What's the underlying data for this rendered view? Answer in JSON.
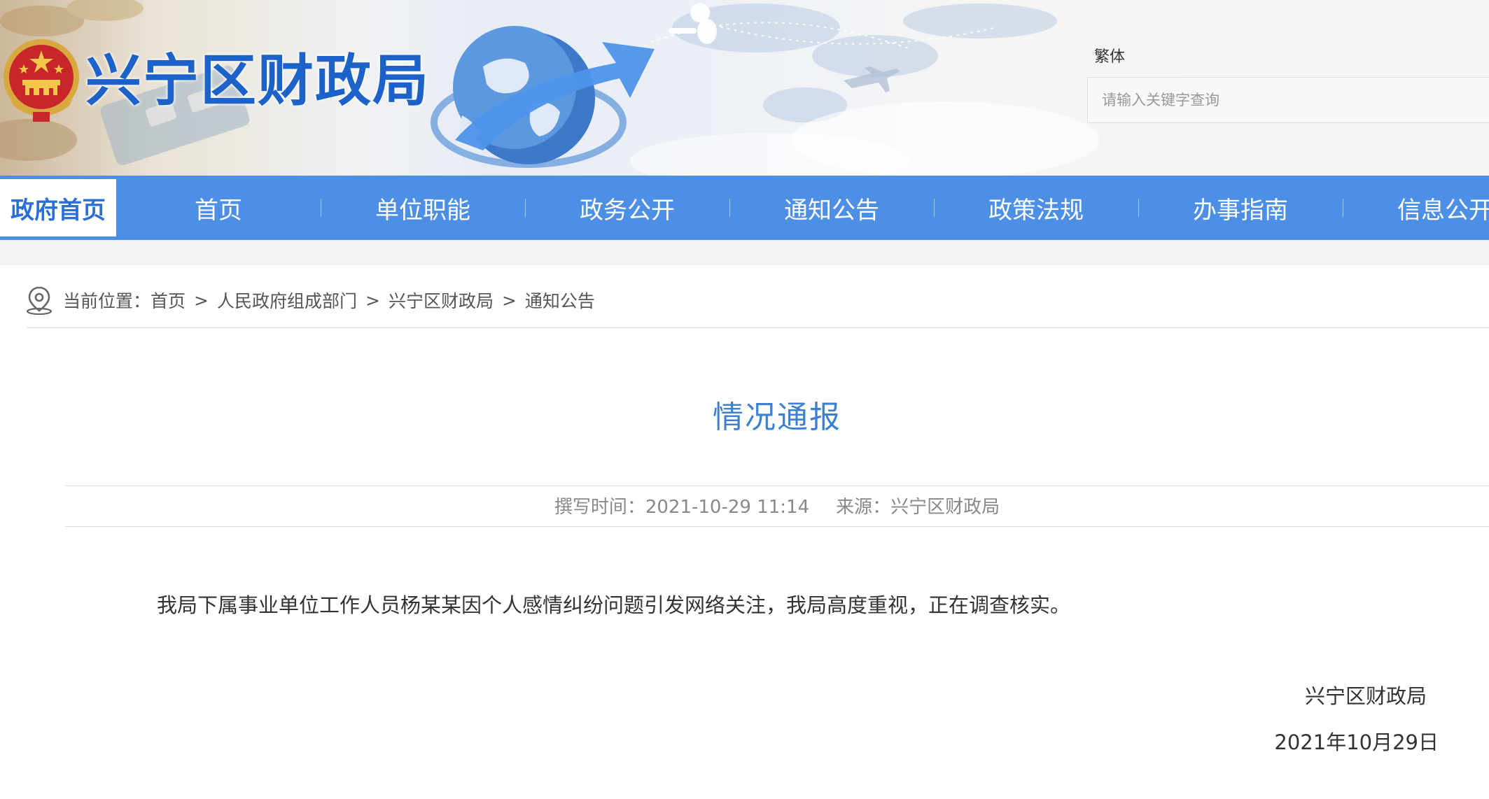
{
  "header": {
    "site_title": "兴宁区财政局",
    "lang_toggle": "繁体",
    "search_placeholder": "请输入关键字查询"
  },
  "nav": {
    "home": "政府首页",
    "items": [
      "首页",
      "单位职能",
      "政务公开",
      "通知公告",
      "政策法规",
      "办事指南",
      "信息公开"
    ]
  },
  "breadcrumb": {
    "label": "当前位置：",
    "items": [
      "首页",
      "人民政府组成部门",
      "兴宁区财政局",
      "通知公告"
    ],
    "separator": ">"
  },
  "article": {
    "title": "情况通报",
    "time_label": "撰写时间：",
    "time_value": "2021-10-29 11:14",
    "source_label": "来源：",
    "source_value": "兴宁区财政局",
    "body": "我局下属事业单位工作人员杨某某因个人感情纠纷问题引发网络关注，我局高度重视，正在调查核实。",
    "signature": "兴宁区财政局",
    "date": "2021年10月29日"
  },
  "colors": {
    "nav_bg": "#4e8fe6",
    "title_blue": "#1d62c9",
    "article_title": "#3d7fd0"
  },
  "icons": {
    "emblem": "national-emblem-icon",
    "location": "location-pin-icon",
    "globe": "globe-arrow-icon"
  }
}
